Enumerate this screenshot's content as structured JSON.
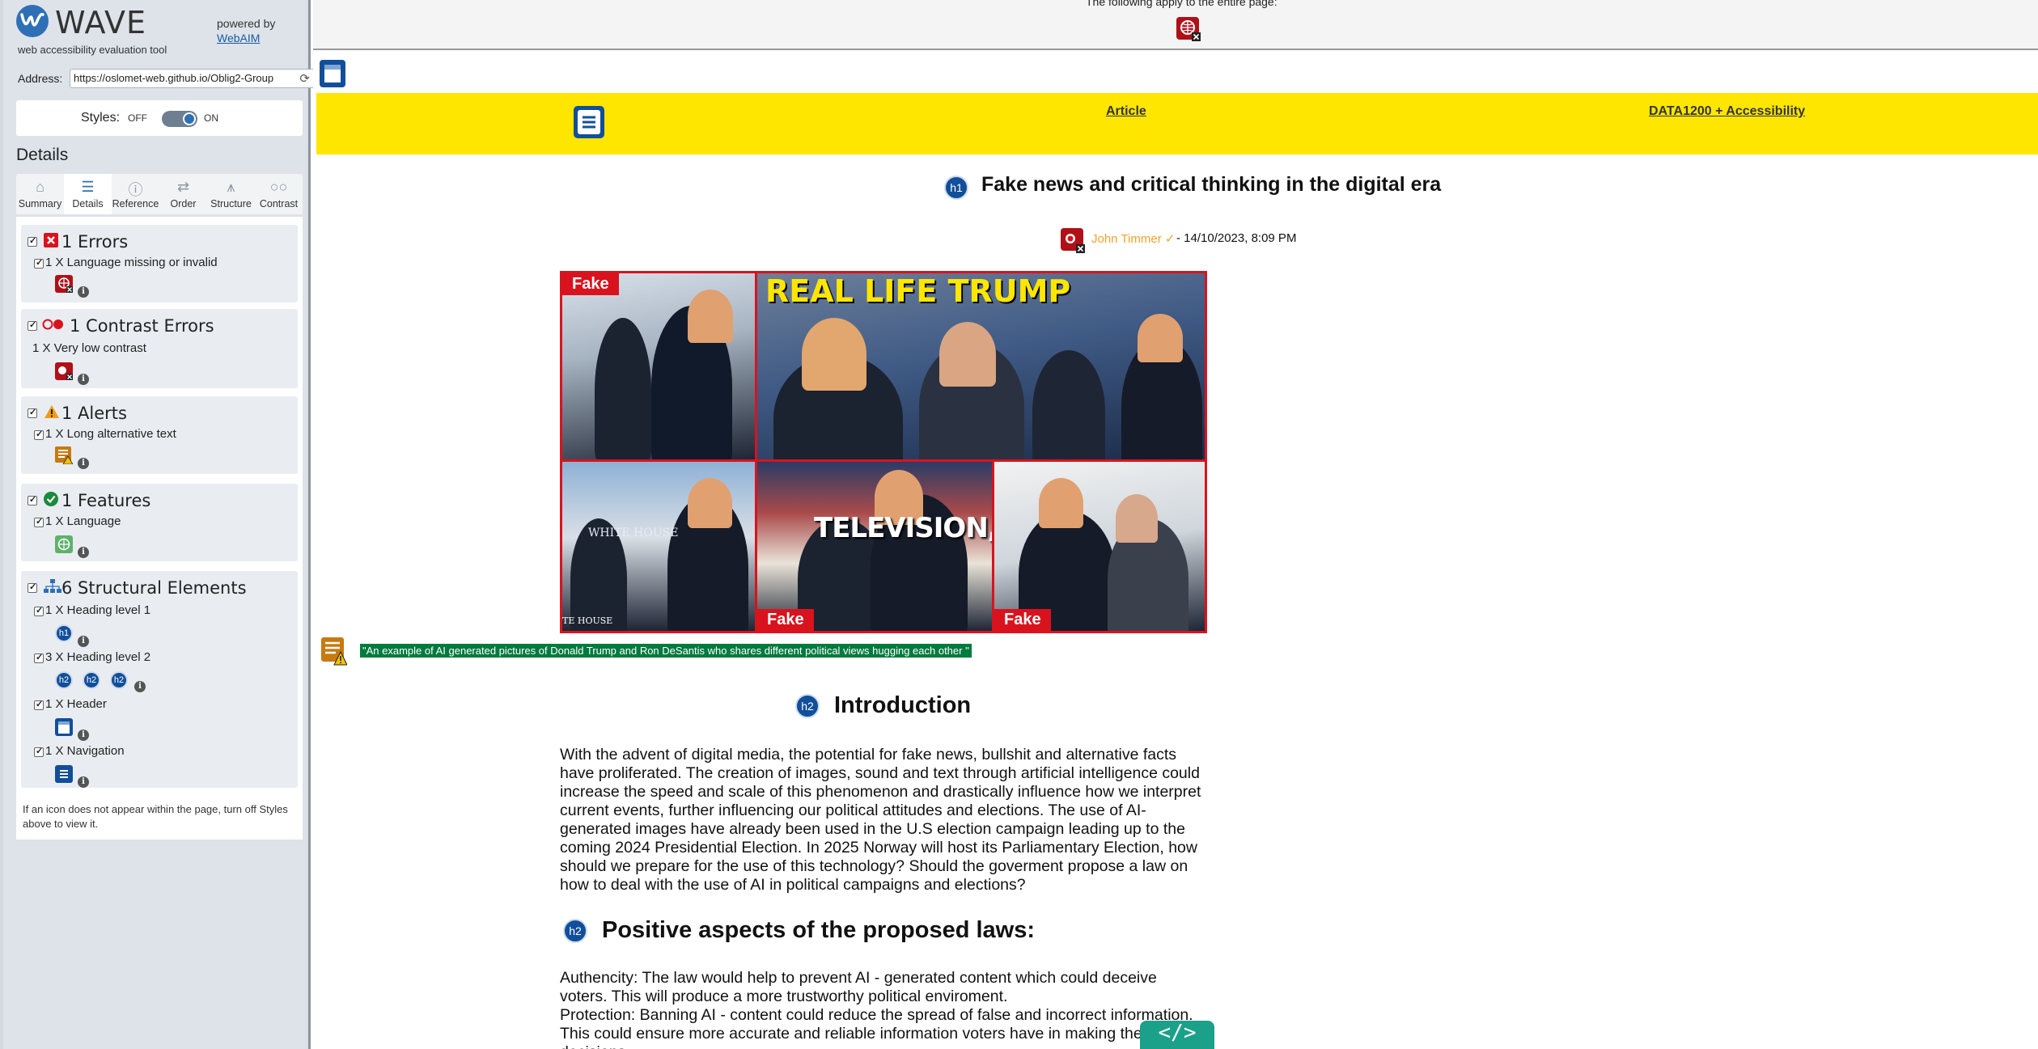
{
  "wave": {
    "logo_word": "WAVE",
    "logo_tagline": "web accessibility evaluation tool",
    "powered_by": "powered by",
    "powered_by_link": "WebAIM",
    "address_label": "Address:",
    "address_value": "https://oslomet-web.github.io/Oblig2-Group",
    "styles_label": "Styles:",
    "styles_off": "OFF",
    "styles_on": "ON",
    "details_title": "Details",
    "tabs": [
      {
        "label": "Summary",
        "icon": "home-icon"
      },
      {
        "label": "Details",
        "icon": "list-icon",
        "active": true
      },
      {
        "label": "Reference",
        "icon": "info-icon"
      },
      {
        "label": "Order",
        "icon": "order-icon"
      },
      {
        "label": "Structure",
        "icon": "structure-icon"
      },
      {
        "label": "Contrast",
        "icon": "contrast-icon"
      }
    ],
    "groups": {
      "errors": {
        "title": "1 Errors",
        "items": [
          "1 X Language missing or invalid"
        ]
      },
      "contrast": {
        "title": "1 Contrast Errors",
        "items": [
          "1 X Very low contrast"
        ]
      },
      "alerts": {
        "title": "1 Alerts",
        "items": [
          "1 X Long alternative text"
        ]
      },
      "features": {
        "title": "1 Features",
        "items": [
          "1 X Language"
        ]
      },
      "structure": {
        "title": "6 Structural Elements",
        "items": [
          "1 X Heading level 1",
          "3 X Heading level 2",
          "1 X Header",
          "1 X Navigation"
        ],
        "h1_badge": "h1",
        "h2_badge": "h2"
      }
    },
    "info_glyph": "i",
    "note": "If an icon does not appear within the page, turn off Styles above to view it."
  },
  "page": {
    "topbar_text": "The following apply to the entire page:",
    "nav_links": [
      "Article",
      "DATA1200 + Accessibility"
    ],
    "h1_badge": "h1",
    "h1": "Fake news and critical thinking in the digital era",
    "author": "John Timmer ✓",
    "date": "- 14/10/2023, 8:09 PM",
    "hero": {
      "fake_label": "Fake",
      "caption_top": "REAL LIFE TRUMP",
      "caption_tv": "TELEVISION,",
      "sign_text": "WHITE HOUSE",
      "podium_text": "TE HOUSE"
    },
    "alt_text": "\"An example of AI generated pictures of Donald Trump and Ron DeSantis who shares different political views hugging each other \"",
    "h2_badge": "h2",
    "section1": {
      "heading": "Introduction",
      "body": "With the advent of digital media, the potential for fake news, bullshit and alternative facts have proliferated. The creation of images, sound and text through artificial intelligence could increase the speed and scale of this phenomenon and drastically influence how we interpret current events, further influencing our political attitudes and elections. The use of AI-generated images have already been used in the U.S election campaign leading up to the coming 2024 Presidential Election. In 2025 Norway will host its Parliamentary Election, how should we prepare for the use of this technology? Should the goverment propose a law on how to deal with the use of AI in political campaigns and elections?"
    },
    "section2": {
      "heading": "Positive aspects of the proposed laws:",
      "line1": "Authencity: The law would help to prevent AI - generated content which could deceive voters. This will produce a more trustworthy political enviroment.",
      "line2": "Protection: Banning AI - content could reduce the spread of false and incorrect information. This could ensure more accurate and reliable information voters have in making their decisions."
    },
    "code_button": "</>"
  },
  "colors": {
    "nav_yellow": "#ffe600",
    "wave_blue": "#2f6fb5",
    "heading_badge": "#124f9a",
    "error_red": "#d9131e",
    "alt_green": "#007a3d",
    "author_orange": "#f2a12e"
  }
}
